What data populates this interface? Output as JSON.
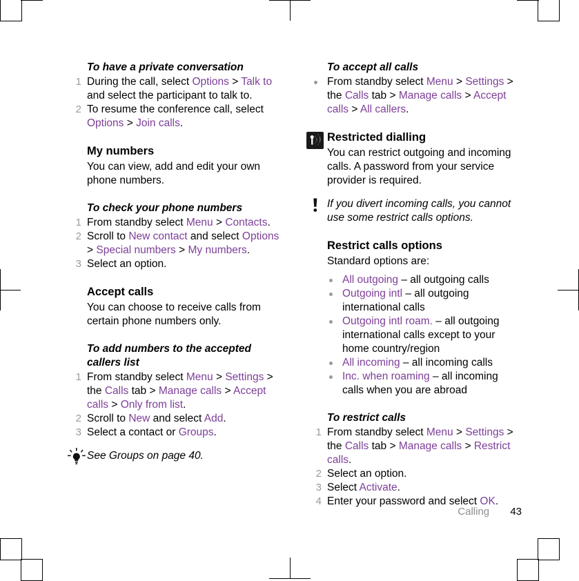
{
  "document": {
    "footer": {
      "chapter": "Calling",
      "page_number": "43"
    },
    "accent_color": "#7d3f98",
    "number_color": "#9a9a9a",
    "bullet_color": "#9a9a9a"
  },
  "left_column": {
    "proc_private_conversation": {
      "heading": "To have a private conversation",
      "steps": [
        {
          "num": "1",
          "parts": [
            {
              "t": "During the call, select ",
              "c": "plain"
            },
            {
              "t": "Options",
              "c": "ui"
            },
            {
              "t": " > ",
              "c": "plain"
            },
            {
              "t": "Talk to",
              "c": "ui"
            },
            {
              "t": " and select the participant to talk to.",
              "c": "plain"
            }
          ]
        },
        {
          "num": "2",
          "parts": [
            {
              "t": "To resume the conference call, select ",
              "c": "plain"
            },
            {
              "t": "Options",
              "c": "ui"
            },
            {
              "t": " > ",
              "c": "plain"
            },
            {
              "t": "Join calls",
              "c": "ui"
            },
            {
              "t": ".",
              "c": "plain"
            }
          ]
        }
      ]
    },
    "sect_my_numbers": {
      "heading": "My numbers",
      "body": "You can view, add and edit your own phone numbers."
    },
    "proc_check_phone_numbers": {
      "heading": "To check your phone numbers",
      "steps": [
        {
          "num": "1",
          "parts": [
            {
              "t": "From standby select ",
              "c": "plain"
            },
            {
              "t": "Menu",
              "c": "ui"
            },
            {
              "t": " > ",
              "c": "plain"
            },
            {
              "t": "Contacts",
              "c": "ui"
            },
            {
              "t": ".",
              "c": "plain"
            }
          ]
        },
        {
          "num": "2",
          "parts": [
            {
              "t": "Scroll to ",
              "c": "plain"
            },
            {
              "t": "New contact",
              "c": "ui"
            },
            {
              "t": " and select ",
              "c": "plain"
            },
            {
              "t": "Options",
              "c": "ui"
            },
            {
              "t": " > ",
              "c": "plain"
            },
            {
              "t": "Special numbers",
              "c": "ui"
            },
            {
              "t": " > ",
              "c": "plain"
            },
            {
              "t": "My numbers",
              "c": "ui"
            },
            {
              "t": ".",
              "c": "plain"
            }
          ]
        },
        {
          "num": "3",
          "parts": [
            {
              "t": "Select an option.",
              "c": "plain"
            }
          ]
        }
      ]
    },
    "sect_accept_calls": {
      "heading": "Accept calls",
      "body": "You can choose to receive calls from certain phone numbers only."
    },
    "proc_add_numbers": {
      "heading": "To add numbers to the accepted callers list",
      "steps": [
        {
          "num": "1",
          "parts": [
            {
              "t": "From standby select ",
              "c": "plain"
            },
            {
              "t": "Menu",
              "c": "ui"
            },
            {
              "t": " > ",
              "c": "plain"
            },
            {
              "t": "Settings",
              "c": "ui"
            },
            {
              "t": " > the ",
              "c": "plain"
            },
            {
              "t": "Calls",
              "c": "ui"
            },
            {
              "t": " tab > ",
              "c": "plain"
            },
            {
              "t": "Manage calls",
              "c": "ui"
            },
            {
              "t": " > ",
              "c": "plain"
            },
            {
              "t": "Accept calls",
              "c": "ui"
            },
            {
              "t": " > ",
              "c": "plain"
            },
            {
              "t": "Only from list",
              "c": "ui"
            },
            {
              "t": ".",
              "c": "plain"
            }
          ]
        },
        {
          "num": "2",
          "parts": [
            {
              "t": "Scroll to ",
              "c": "plain"
            },
            {
              "t": "New",
              "c": "ui"
            },
            {
              "t": " and select ",
              "c": "plain"
            },
            {
              "t": "Add",
              "c": "ui"
            },
            {
              "t": ".",
              "c": "plain"
            }
          ]
        },
        {
          "num": "3",
          "parts": [
            {
              "t": "Select a contact or ",
              "c": "plain"
            },
            {
              "t": "Groups",
              "c": "ui"
            },
            {
              "t": ".",
              "c": "plain"
            }
          ]
        }
      ]
    },
    "tip": {
      "icon": "lightbulb-tip-icon",
      "text": "See Groups on page 40."
    }
  },
  "right_column": {
    "proc_accept_all_calls": {
      "heading": "To accept all calls",
      "bullet_steps": [
        {
          "parts": [
            {
              "t": "From standby select ",
              "c": "plain"
            },
            {
              "t": "Menu",
              "c": "ui"
            },
            {
              "t": " > ",
              "c": "plain"
            },
            {
              "t": "Settings",
              "c": "ui"
            },
            {
              "t": " > the ",
              "c": "plain"
            },
            {
              "t": "Calls",
              "c": "ui"
            },
            {
              "t": " tab > ",
              "c": "plain"
            },
            {
              "t": "Manage calls",
              "c": "ui"
            },
            {
              "t": " > ",
              "c": "plain"
            },
            {
              "t": "Accept calls",
              "c": "ui"
            },
            {
              "t": " > ",
              "c": "plain"
            },
            {
              "t": "All callers",
              "c": "ui"
            },
            {
              "t": ".",
              "c": "plain"
            }
          ]
        }
      ]
    },
    "sect_restricted_dialling": {
      "icon": "signal-tower-icon",
      "heading": "Restricted dialling",
      "body": "You can restrict outgoing and incoming calls. A password from your service provider is required."
    },
    "note": {
      "icon": "exclamation-note-icon",
      "text": "If you divert incoming calls, you cannot use some restrict calls options."
    },
    "sect_restrict_calls_options": {
      "heading": "Restrict calls options",
      "intro": "Standard options are:",
      "options": [
        {
          "parts": [
            {
              "t": "All outgoing",
              "c": "ui"
            },
            {
              "t": " – all outgoing calls",
              "c": "plain"
            }
          ]
        },
        {
          "parts": [
            {
              "t": "Outgoing intl",
              "c": "ui"
            },
            {
              "t": " – all outgoing international calls",
              "c": "plain"
            }
          ]
        },
        {
          "parts": [
            {
              "t": "Outgoing intl roam.",
              "c": "ui"
            },
            {
              "t": " – all outgoing international calls except to your home country/region",
              "c": "plain"
            }
          ]
        },
        {
          "parts": [
            {
              "t": "All incoming",
              "c": "ui"
            },
            {
              "t": " – all incoming calls",
              "c": "plain"
            }
          ]
        },
        {
          "parts": [
            {
              "t": "Inc. when roaming",
              "c": "ui"
            },
            {
              "t": " – all incoming calls when you are abroad",
              "c": "plain"
            }
          ]
        }
      ]
    },
    "proc_restrict_calls": {
      "heading": "To restrict calls",
      "steps": [
        {
          "num": "1",
          "parts": [
            {
              "t": "From standby select ",
              "c": "plain"
            },
            {
              "t": "Menu",
              "c": "ui"
            },
            {
              "t": " > ",
              "c": "plain"
            },
            {
              "t": "Settings",
              "c": "ui"
            },
            {
              "t": " > the ",
              "c": "plain"
            },
            {
              "t": "Calls",
              "c": "ui"
            },
            {
              "t": " tab > ",
              "c": "plain"
            },
            {
              "t": "Manage calls",
              "c": "ui"
            },
            {
              "t": " > ",
              "c": "plain"
            },
            {
              "t": "Restrict calls",
              "c": "ui"
            },
            {
              "t": ".",
              "c": "plain"
            }
          ]
        },
        {
          "num": "2",
          "parts": [
            {
              "t": "Select an option.",
              "c": "plain"
            }
          ]
        },
        {
          "num": "3",
          "parts": [
            {
              "t": "Select ",
              "c": "plain"
            },
            {
              "t": "Activate",
              "c": "ui"
            },
            {
              "t": ".",
              "c": "plain"
            }
          ]
        },
        {
          "num": "4",
          "parts": [
            {
              "t": "Enter your password and select ",
              "c": "plain"
            },
            {
              "t": "OK",
              "c": "ui"
            },
            {
              "t": ".",
              "c": "plain"
            }
          ]
        }
      ]
    }
  }
}
